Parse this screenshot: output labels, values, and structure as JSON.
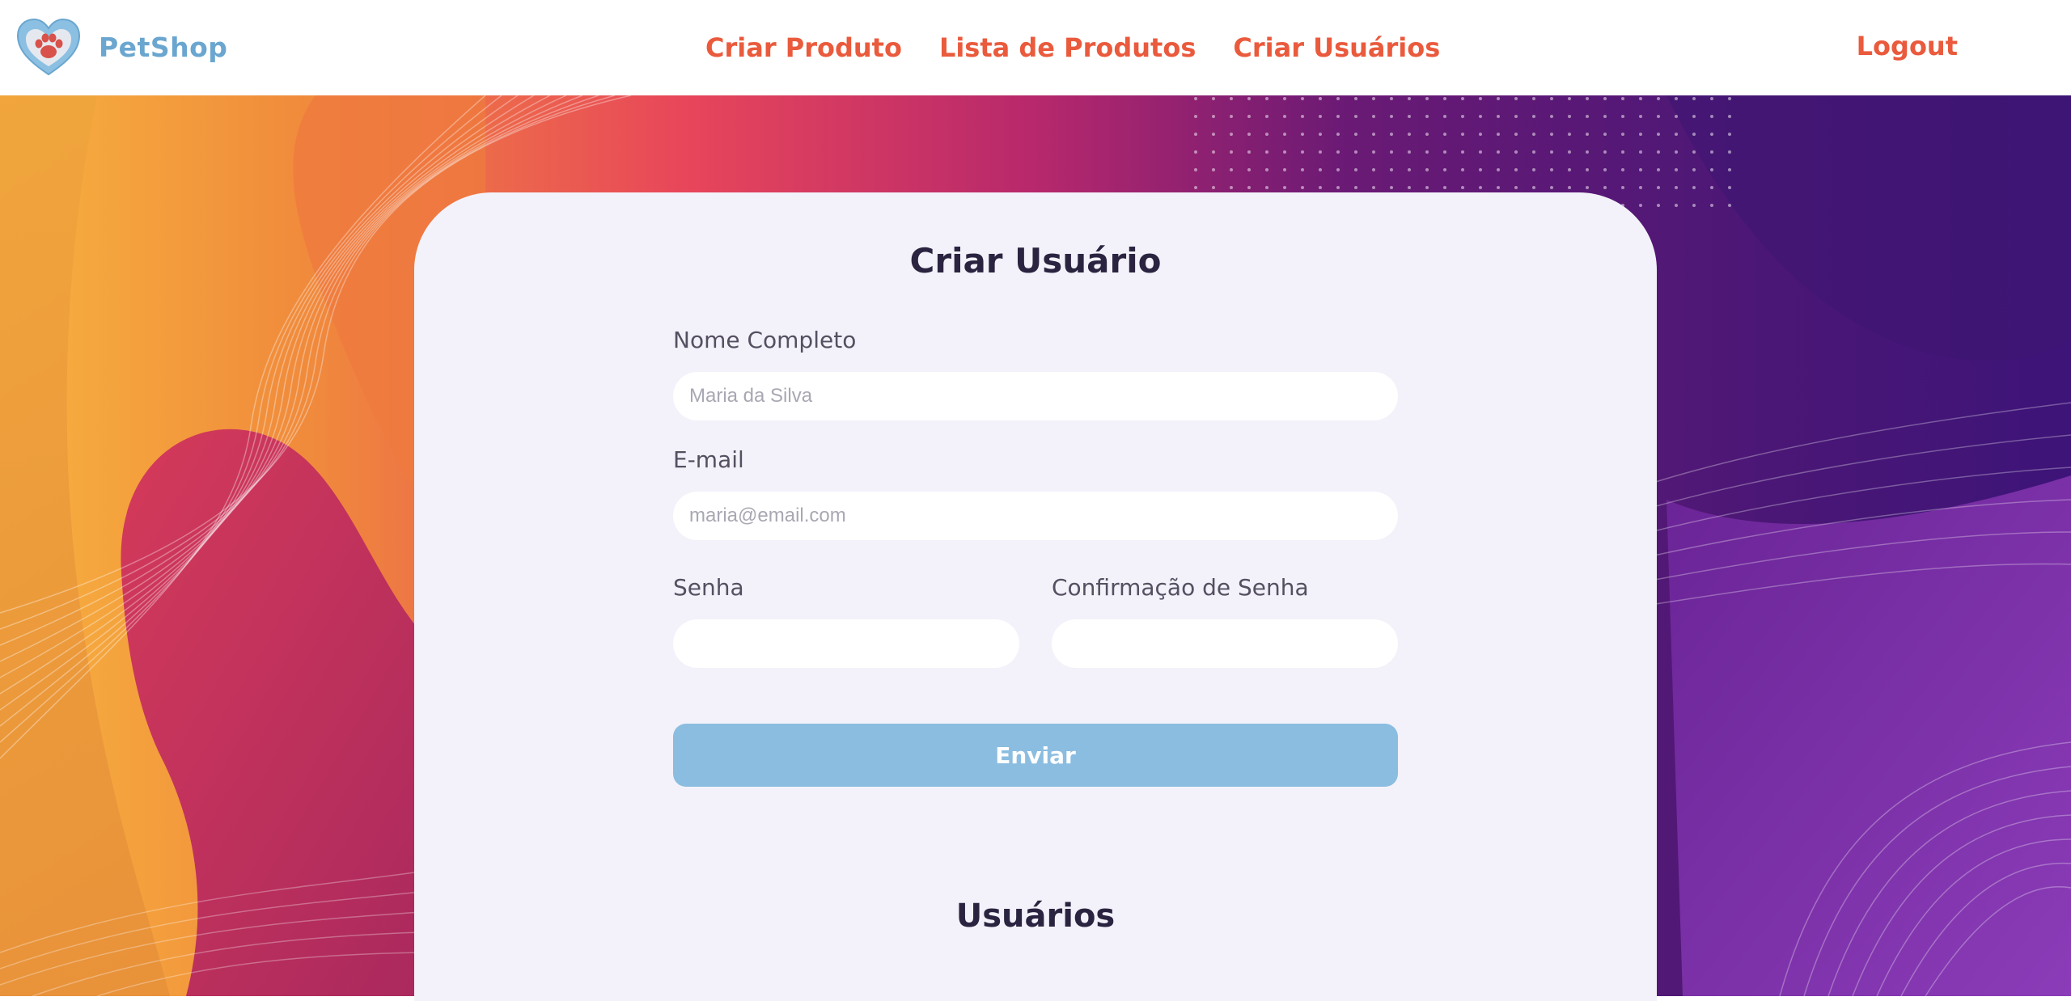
{
  "header": {
    "brand": "PetShop",
    "nav": [
      "Criar Produto",
      "Lista de Produtos",
      "Criar Usuários"
    ],
    "logout": "Logout"
  },
  "form": {
    "title": "Criar Usuário",
    "name_label": "Nome Completo",
    "name_placeholder": "Maria da Silva",
    "email_label": "E-mail",
    "email_placeholder": "maria@email.com",
    "password_label": "Senha",
    "confirm_label": "Confirmação de Senha",
    "submit_label": "Enviar"
  },
  "users_section": {
    "title": "Usuários"
  },
  "colors": {
    "nav_accent": "#ea5a3c",
    "brand": "#6aa6cf",
    "submit": "#8bbde0"
  }
}
